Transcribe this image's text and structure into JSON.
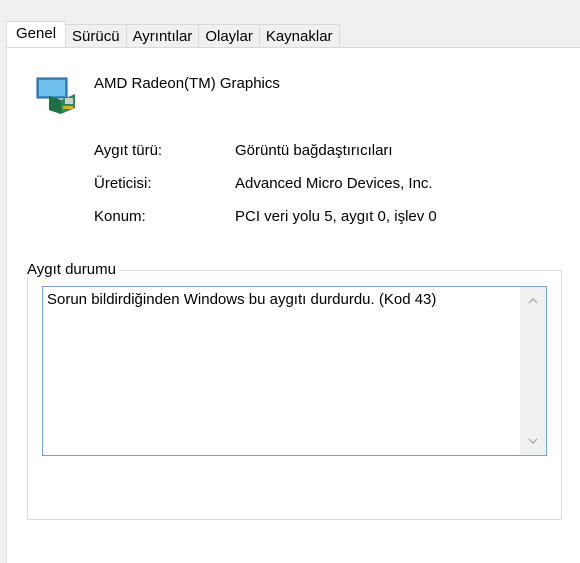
{
  "tabs": [
    "Genel",
    "Sürücü",
    "Ayrıntılar",
    "Olaylar",
    "Kaynaklar"
  ],
  "active_tab": "Genel",
  "device": {
    "name": "AMD Radeon(TM) Graphics",
    "icon": "display-adapter-icon"
  },
  "properties": [
    {
      "label": "Aygıt türü:",
      "value": "Görüntü bağdaştırıcıları"
    },
    {
      "label": "Üreticisi:",
      "value": "Advanced Micro Devices, Inc."
    },
    {
      "label": "Konum:",
      "value": "PCI veri yolu 5, aygıt 0, işlev 0"
    }
  ],
  "status": {
    "group_title": "Aygıt durumu",
    "text": "Sorun bildirdiğinden Windows bu aygıtı durdurdu. (Kod 43)"
  },
  "colors": {
    "panel_bg": "#ffffff",
    "window_bg": "#f0f0f0",
    "status_border": "#7a9ed6"
  }
}
